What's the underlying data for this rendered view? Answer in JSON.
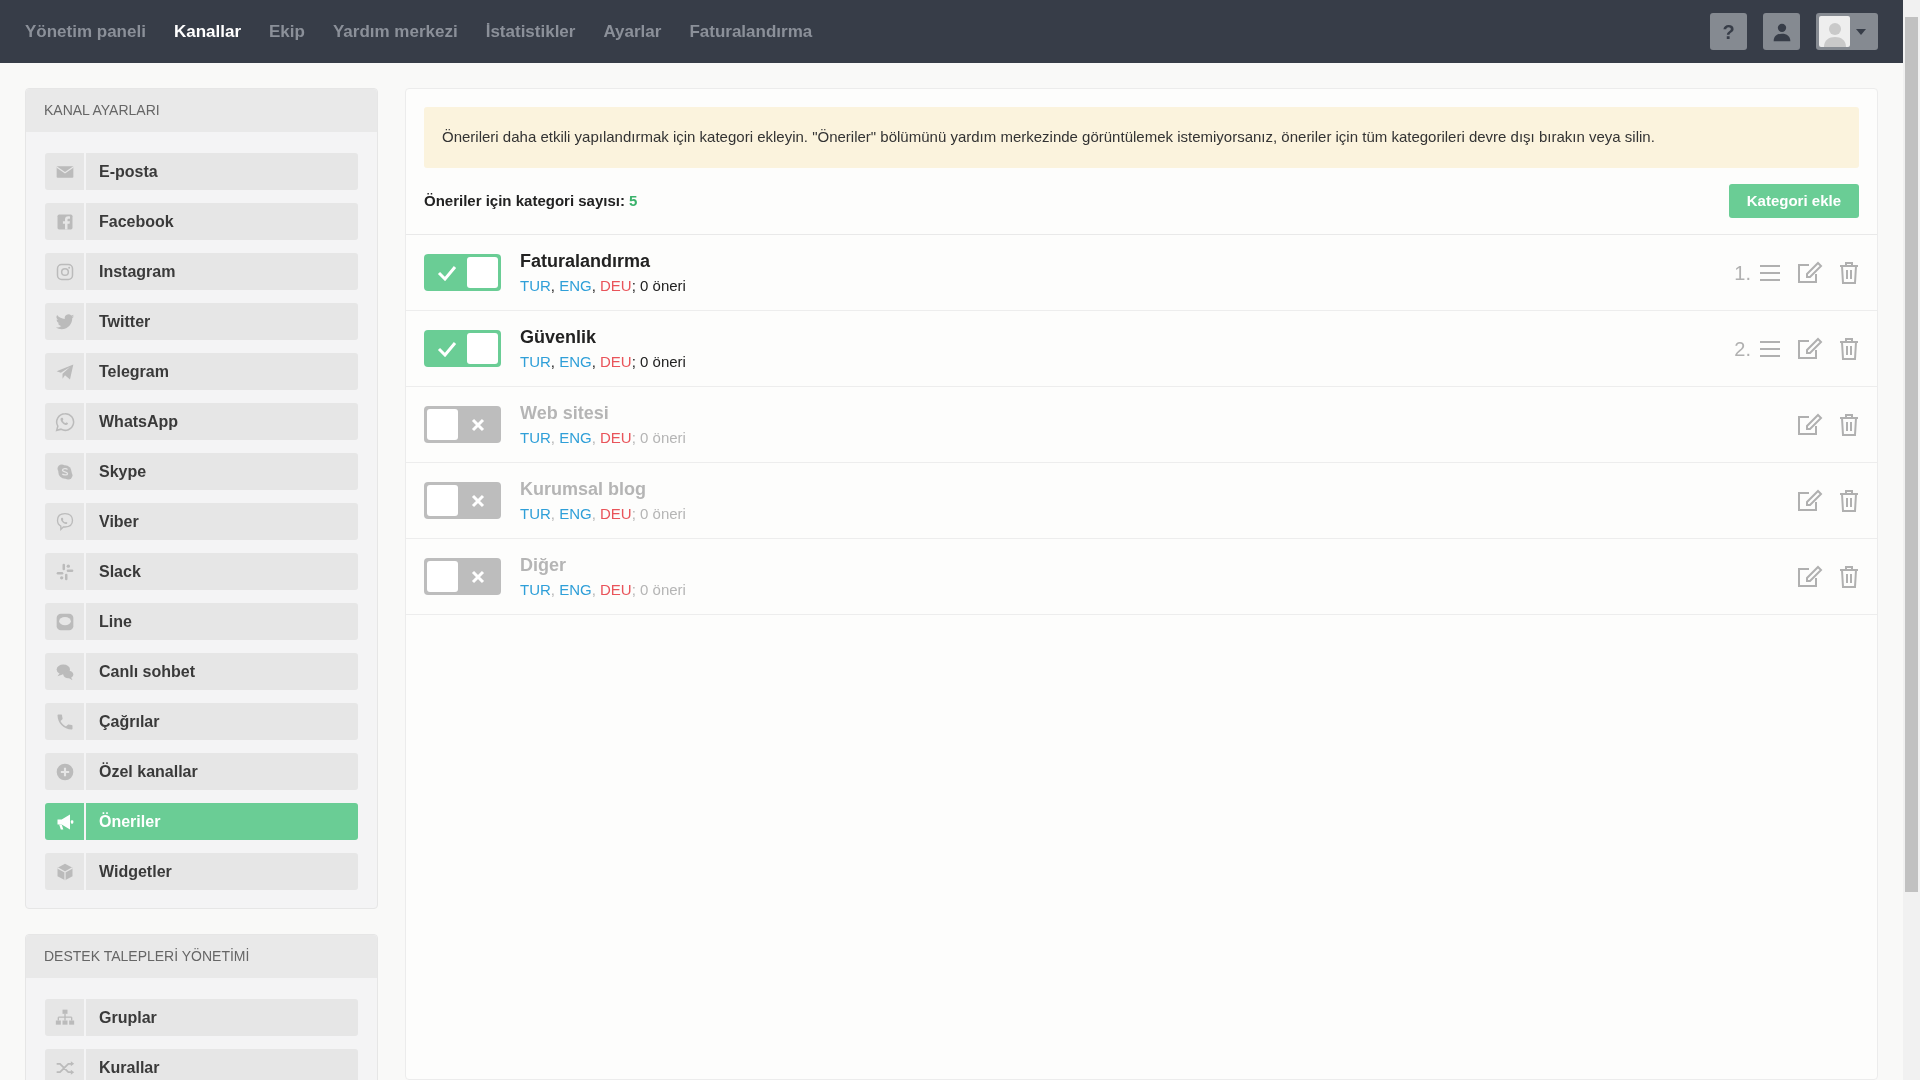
{
  "navbar": {
    "links": [
      {
        "label": "Yönetim paneli",
        "selected": false
      },
      {
        "label": "Kanallar",
        "selected": true
      },
      {
        "label": "Ekip",
        "selected": false
      },
      {
        "label": "Yardım merkezi",
        "selected": false
      },
      {
        "label": "İstatistikler",
        "selected": false
      },
      {
        "label": "Ayarlar",
        "selected": false
      },
      {
        "label": "Faturalandırma",
        "selected": false
      }
    ],
    "help_button": "?"
  },
  "sidebar": [
    {
      "title": "KANAL AYARLARI",
      "items": [
        {
          "label": "E-posta",
          "selected": false
        },
        {
          "label": "Facebook",
          "selected": false
        },
        {
          "label": "Instagram",
          "selected": false
        },
        {
          "label": "Twitter",
          "selected": false
        },
        {
          "label": "Telegram",
          "selected": false
        },
        {
          "label": "WhatsApp",
          "selected": false
        },
        {
          "label": "Skype",
          "selected": false
        },
        {
          "label": "Viber",
          "selected": false
        },
        {
          "label": "Slack",
          "selected": false
        },
        {
          "label": "Line",
          "selected": false
        },
        {
          "label": "Canlı sohbet",
          "selected": false
        },
        {
          "label": "Çağrılar",
          "selected": false
        },
        {
          "label": "Özel kanallar",
          "selected": false
        },
        {
          "label": "Öneriler",
          "selected": true
        },
        {
          "label": "Widgetler",
          "selected": false
        }
      ]
    },
    {
      "title": "DESTEK TALEPLERİ YÖNETİMİ",
      "items": [
        {
          "label": "Gruplar",
          "selected": false
        },
        {
          "label": "Kurallar",
          "selected": false
        }
      ]
    }
  ],
  "main": {
    "alert": "Önerileri daha etkili yapılandırmak için kategori ekleyin. \"Öneriler\" bölümünü yardım merkezinde görüntülemek istemiyorsanız, öneriler için tüm kategorileri devre dışı bırakın veya silin.",
    "count_label": "Öneriler için kategori sayısı:",
    "count": "5",
    "add_button": "Kategori ekle",
    "categories": [
      {
        "title": "Faturalandırma",
        "on": true,
        "order": "1.",
        "languages": [
          {
            "code": "TUR",
            "sep": ",",
            "color": "#2f9fd8"
          },
          {
            "code": "ENG",
            "sep": ",",
            "color": "#2f9fd8"
          },
          {
            "code": "DEU",
            "sep": ";",
            "color": "#e9545a"
          }
        ],
        "count": "0 öneri"
      },
      {
        "title": "Güvenlik",
        "on": true,
        "order": "2.",
        "languages": [
          {
            "code": "TUR",
            "sep": ",",
            "color": "#2f9fd8"
          },
          {
            "code": "ENG",
            "sep": ",",
            "color": "#2f9fd8"
          },
          {
            "code": "DEU",
            "sep": ";",
            "color": "#e9545a"
          }
        ],
        "count": "0 öneri"
      },
      {
        "title": "Web sitesi",
        "on": false,
        "languages": [
          {
            "code": "TUR",
            "sep": ",",
            "color": "#2f9fd8"
          },
          {
            "code": "ENG",
            "sep": ",",
            "color": "#2f9fd8"
          },
          {
            "code": "DEU",
            "sep": ";",
            "color": "#e9545a"
          }
        ],
        "count": "0 öneri"
      },
      {
        "title": "Kurumsal blog",
        "on": false,
        "languages": [
          {
            "code": "TUR",
            "sep": ",",
            "color": "#2f9fd8"
          },
          {
            "code": "ENG",
            "sep": ",",
            "color": "#2f9fd8"
          },
          {
            "code": "DEU",
            "sep": ";",
            "color": "#e9545a"
          }
        ],
        "count": "0 öneri"
      },
      {
        "title": "Diğer",
        "on": false,
        "languages": [
          {
            "code": "TUR",
            "sep": ",",
            "color": "#2f9fd8"
          },
          {
            "code": "ENG",
            "sep": ",",
            "color": "#2f9fd8"
          },
          {
            "code": "DEU",
            "sep": ";",
            "color": "#e9545a"
          }
        ],
        "count": "0 öneri"
      }
    ]
  }
}
